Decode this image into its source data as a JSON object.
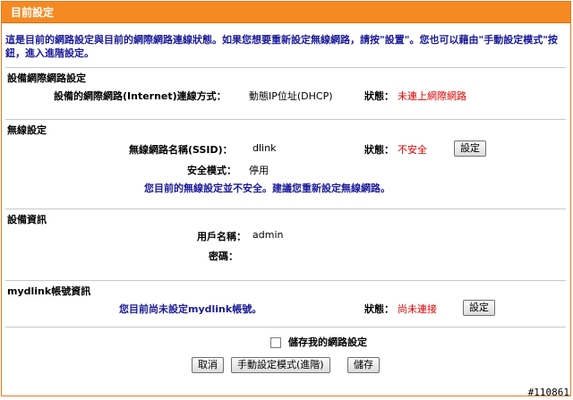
{
  "panel": {
    "title": "目前設定"
  },
  "intro": "這是目前的網路設定與目前的網際網路連線狀態。如果您想要重新設定無線網路，請按\"設置\"。您也可以藉由\"手動設定模式\"按鈕，進入進階設定。",
  "internet": {
    "title": "設備網際網路設定",
    "conn_label": "設備的網際網路(Internet)連線方式：",
    "conn_value": "動態IP位址(DHCP)",
    "status_label": "狀態：",
    "status_value": "未連上網際網路"
  },
  "wireless": {
    "title": "無線設定",
    "ssid_label": "無線網路名稱(SSID)：",
    "ssid_value": "dlink",
    "status_label": "狀態：",
    "status_value": "不安全",
    "setup_button": "設定",
    "security_label": "安全模式：",
    "security_value": "停用",
    "warning": "您目前的無線設定並不安全。建議您重新設定無線網路。"
  },
  "device": {
    "title": "設備資訊",
    "user_label": "用戶名稱：",
    "user_value": "admin",
    "password_label": "密碼："
  },
  "mydlink": {
    "title": "mydlink帳號資訊",
    "note": "您目前尚未設定mydlink帳號。",
    "status_label": "狀態：",
    "status_value": "尚未連接",
    "setup_button": "設定"
  },
  "footer": {
    "save_network_label": "儲存我的網路設定",
    "save_network_checked": false,
    "cancel_button": "取消",
    "manual_button": "手動設定模式(進階)",
    "save_button": "儲存"
  },
  "watermark": "#110861",
  "colors": {
    "header": "#f58a22",
    "status_red": "#e00000",
    "note_blue": "#1a1a99"
  }
}
